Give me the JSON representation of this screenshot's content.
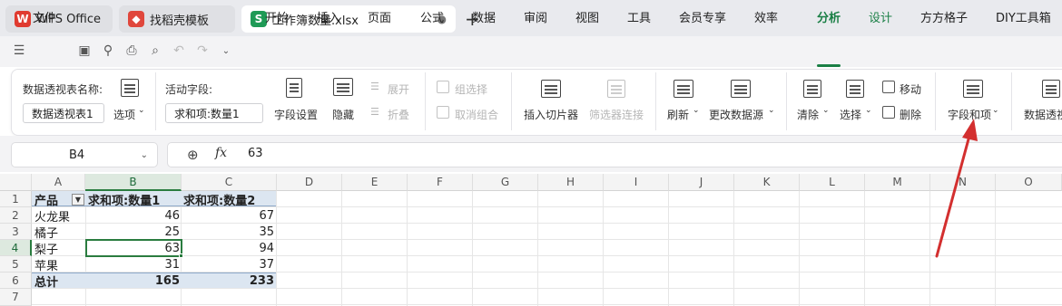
{
  "tabs": [
    {
      "label": "WPS Office",
      "icon": "wps-logo-icon"
    },
    {
      "label": "找稻壳模板",
      "icon": "docer-logo-icon"
    },
    {
      "label": "工作簿数量.xlsx",
      "icon": "spreadsheet-s-icon",
      "icon_letter": "S"
    }
  ],
  "menu": {
    "file": "文件",
    "items": [
      "开始",
      "插入",
      "页面",
      "公式",
      "数据",
      "审阅",
      "视图",
      "工具",
      "会员专享",
      "效率",
      "分析",
      "设计",
      "方方格子",
      "DIY工具箱"
    ],
    "active": "分析"
  },
  "ribbon": {
    "pivot_name_label": "数据透视表名称:",
    "pivot_name_value": "数据透视表1",
    "options": "选项",
    "active_field_label": "活动字段:",
    "active_field_value": "求和项:数量1",
    "field_settings": "字段设置",
    "hide": "隐藏",
    "expand": "展开",
    "collapse": "折叠",
    "group_selection": "组选择",
    "ungroup": "取消组合",
    "insert_slicer": "插入切片器",
    "filter_connections": "筛选器连接",
    "refresh": "刷新",
    "change_source": "更改数据源",
    "clear": "清除",
    "select": "选择",
    "move": "移动",
    "delete": "删除",
    "fields_items": "字段和项",
    "pivot_chart": "数据透视"
  },
  "formula_bar": {
    "cell_ref": "B4",
    "fx": "fx",
    "value": "63"
  },
  "sheet": {
    "columns": [
      "A",
      "B",
      "C",
      "D",
      "E",
      "F",
      "G",
      "H",
      "I",
      "J",
      "K",
      "L",
      "M",
      "N",
      "O"
    ],
    "rows": [
      "1",
      "2",
      "3",
      "4",
      "5",
      "6",
      "7"
    ],
    "selected_cell": "B4",
    "header": [
      "产品",
      "求和项:数量1",
      "求和项:数量2"
    ],
    "data": [
      [
        "火龙果",
        "46",
        "67"
      ],
      [
        "橘子",
        "25",
        "35"
      ],
      [
        "梨子",
        "63",
        "94"
      ],
      [
        "苹果",
        "31",
        "37"
      ]
    ],
    "total": [
      "总计",
      "165",
      "233"
    ]
  },
  "colors": {
    "accent": "#1a7f45",
    "annotation_arrow": "#d32f2f",
    "pivot_header_bg": "#dce6f1",
    "pivot_total_bg": "#dce6f1"
  }
}
